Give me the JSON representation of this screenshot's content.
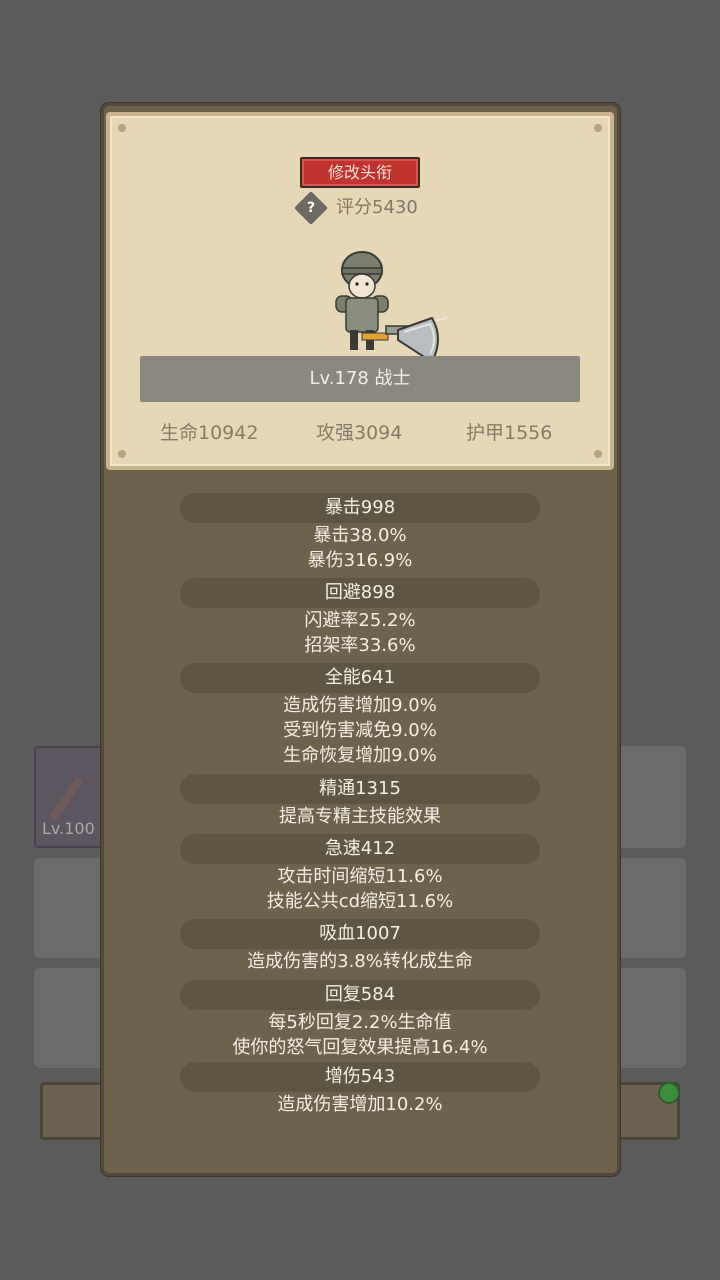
{
  "background": {
    "item_level": "Lv.100"
  },
  "panel": {
    "title_button": "修改头衔",
    "score": "评分5430",
    "level_class": "Lv.178 战士",
    "stats": {
      "hp": "生命10942",
      "attack": "攻强3094",
      "armor": "护甲1556"
    },
    "attributes": [
      {
        "head": "暴击998",
        "lines": [
          "暴击38.0%",
          "暴伤316.9%"
        ]
      },
      {
        "head": "回避898",
        "lines": [
          "闪避率25.2%",
          "招架率33.6%"
        ]
      },
      {
        "head": "全能641",
        "lines": [
          "造成伤害增加9.0%",
          "受到伤害减免9.0%",
          "生命恢复增加9.0%"
        ]
      },
      {
        "head": "精通1315",
        "lines": [
          "提高专精主技能效果"
        ]
      },
      {
        "head": "急速412",
        "lines": [
          "攻击时间缩短11.6%",
          "技能公共cd缩短11.6%"
        ]
      },
      {
        "head": "吸血1007",
        "lines": [
          "造成伤害的3.8%转化成生命"
        ]
      },
      {
        "head": "回复584",
        "lines": [
          "每5秒回复2.2%生命值",
          "使你的怒气回复效果提高16.4%"
        ]
      },
      {
        "head": "增伤543",
        "lines": [
          "造成伤害增加10.2%"
        ]
      }
    ]
  },
  "colors": {
    "title_button": "#c0332e",
    "panel": "#6f624c",
    "card": "#e6d7b7"
  }
}
